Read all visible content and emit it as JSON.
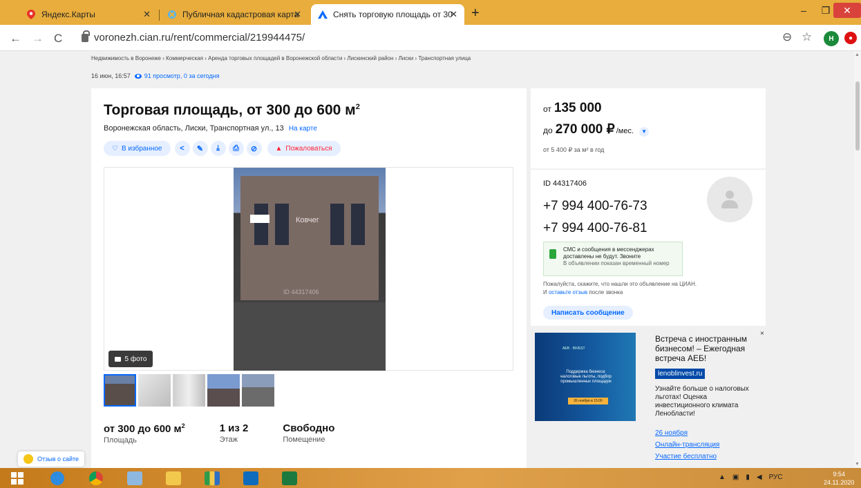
{
  "browser": {
    "tabs": [
      {
        "title": "Яндекс.Карты"
      },
      {
        "title": "Публичная кадастровая карта"
      },
      {
        "title": "Снять торговую площадь от 30"
      }
    ],
    "close_glyph": "✕",
    "new_tab_glyph": "+",
    "url": "voronezh.cian.ru/rent/commercial/219944475/",
    "profile_initial": "Н",
    "controls": {
      "minimize": "–",
      "maximize": "❐",
      "close": "✕"
    },
    "nav": {
      "back": "←",
      "forward": "→",
      "reload": "C"
    },
    "icons": {
      "zoom": "⊖",
      "star": "☆"
    }
  },
  "breadcrumbs": "Недвижимость в Воронеже  ›  Коммерческая  ›  Аренда торговых площадей в Воронежской области  ›  Лискинский район  ›  Лиски  ›  Транспортная улица",
  "published": "16 июн, 16:57",
  "views": "91 просмотр, 0 за сегодня",
  "listing": {
    "title": "Торговая площадь, от 300 до 600 м",
    "title_sup": "2",
    "address": "Воронежская область, Лиски, Транспортная ул., 13",
    "map_link": "На карте",
    "favorite_label": "В избранное",
    "complain_label": "Пожаловаться",
    "action_icons": {
      "share": "<",
      "edit": "✎",
      "download": "⤓",
      "print": "⎙",
      "hide": "⊘"
    },
    "photo_sign": "Ковчег",
    "photo_watermark": "ID 44317406",
    "photo_count": "5 фото",
    "stats": [
      {
        "value": "от 300 до 600 м",
        "sup": "2",
        "label": "Площадь"
      },
      {
        "value": "1 из 2",
        "sup": "",
        "label": "Этаж"
      },
      {
        "value": "Свободно",
        "sup": "",
        "label": "Помещение"
      }
    ]
  },
  "price": {
    "from_prefix": "от",
    "from_amount": "135 000",
    "to_prefix": "до",
    "to_amount": "270 000 ₽",
    "unit": "/мес.",
    "per_m2": "от 5 400 ₽ за м² в год"
  },
  "contact": {
    "id": "ID 44317406",
    "phone1": "+7 994 400-76-73",
    "phone2": "+7 994 400-76-81",
    "sms_line1": "СМС и сообщения в мессенджерах",
    "sms_line2": "доставлены не будут. Звоните",
    "sms_note": "В объявлении показан временный номер",
    "feedback_pre": "Пожалуйста, скажите, что нашли это объявление на ЦИАН. И",
    "feedback_link": "оставьте отзыв",
    "feedback_post": "после звонка",
    "write_button": "Написать сообщение"
  },
  "ad": {
    "title": "Встреча с иностранным бизнесом! – Ежегодная встреча АЕБ!",
    "badge": "lenoblinvest.ru",
    "description": "Узнайте больше о налоговых льготах! Оценка инвестиционного климата Ленобласти!",
    "links": [
      "26 ноября",
      "Онлайн-трансляция",
      "Участие бесплатно"
    ],
    "image_text": "Поддержка бизнеса: налоговые льготы, подбор промышленных площадок",
    "image_button": "26 ноября в 15:00",
    "close_glyph": "×"
  },
  "feedback_widget": "Отзыв о сайте",
  "taskbar": {
    "lang": "РУС",
    "time": "9:54",
    "date": "24.11.2020"
  }
}
